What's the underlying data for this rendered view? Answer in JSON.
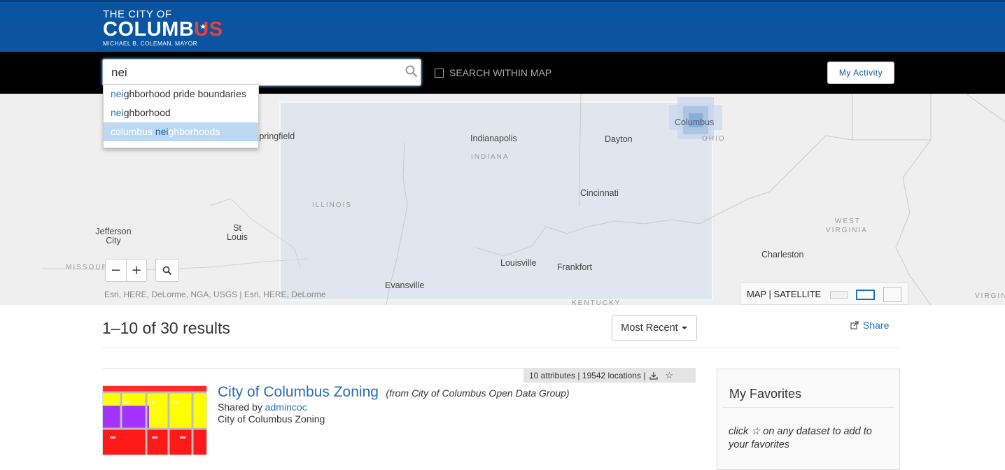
{
  "header": {
    "logo_line1": "THE CITY OF",
    "logo_line2_a": "COLUMB",
    "logo_line2_b": "US",
    "logo_line3": "MICHAEL B. COLEMAN, MAYOR",
    "brand_color": "#0b54a0",
    "accent_color": "#e8413b"
  },
  "search": {
    "value": "nei",
    "within_map_label": "SEARCH WITHIN MAP",
    "within_map_checked": false,
    "icon": "search-icon"
  },
  "my_activity_label": "My Activity",
  "autocomplete": [
    {
      "prefix": "",
      "match": "nei",
      "suffix": "ghborhood pride boundaries",
      "active": false
    },
    {
      "prefix": "",
      "match": "nei",
      "suffix": "ghborhood",
      "active": false
    },
    {
      "prefix": "columbus ",
      "match": "nei",
      "suffix": "ghborhoods",
      "active": true
    }
  ],
  "map": {
    "labels": {
      "springfield": "Springfield",
      "indianapolis": "Indianapolis",
      "dayton": "Dayton",
      "columbus": "Columbus",
      "cincinnati": "Cincinnati",
      "jefferson_city": "Jefferson City",
      "st_louis": "St Louis",
      "louisville": "Louisville",
      "frankfort": "Frankfort",
      "evansville": "Evansville",
      "charleston": "Charleston"
    },
    "states": {
      "indiana": "INDIANA",
      "illinois": "ILLINOIS",
      "ohio": "OHIO",
      "west_virginia_1": "WEST",
      "west_virginia_2": "VIRGINIA",
      "missouri": "MISSOURI",
      "kentucky": "KENTUCKY",
      "virginia": "VIRGIN"
    },
    "zoom_out": "−",
    "zoom_in": "+",
    "attribution": "Esri, HERE, DeLorme, NGA, USGS |  Esri, HERE, DeLorme",
    "basemap_label": "MAP | SATELLITE"
  },
  "results": {
    "count_label": "1–10 of 30 results",
    "sort_label": "Most Recent",
    "share_label": "Share"
  },
  "dataset": {
    "stats": "10 attributes | 19542 locations |",
    "title": "City of Columbus Zoning",
    "source": "(from City of Columbus Open Data Group)",
    "shared_by_label": "Shared by",
    "owner": "admincoc",
    "description": "City of Columbus Zoning"
  },
  "favorites": {
    "heading": "My Favorites",
    "hint_a": "click",
    "hint_b": "on any dataset to add to your favorites"
  }
}
